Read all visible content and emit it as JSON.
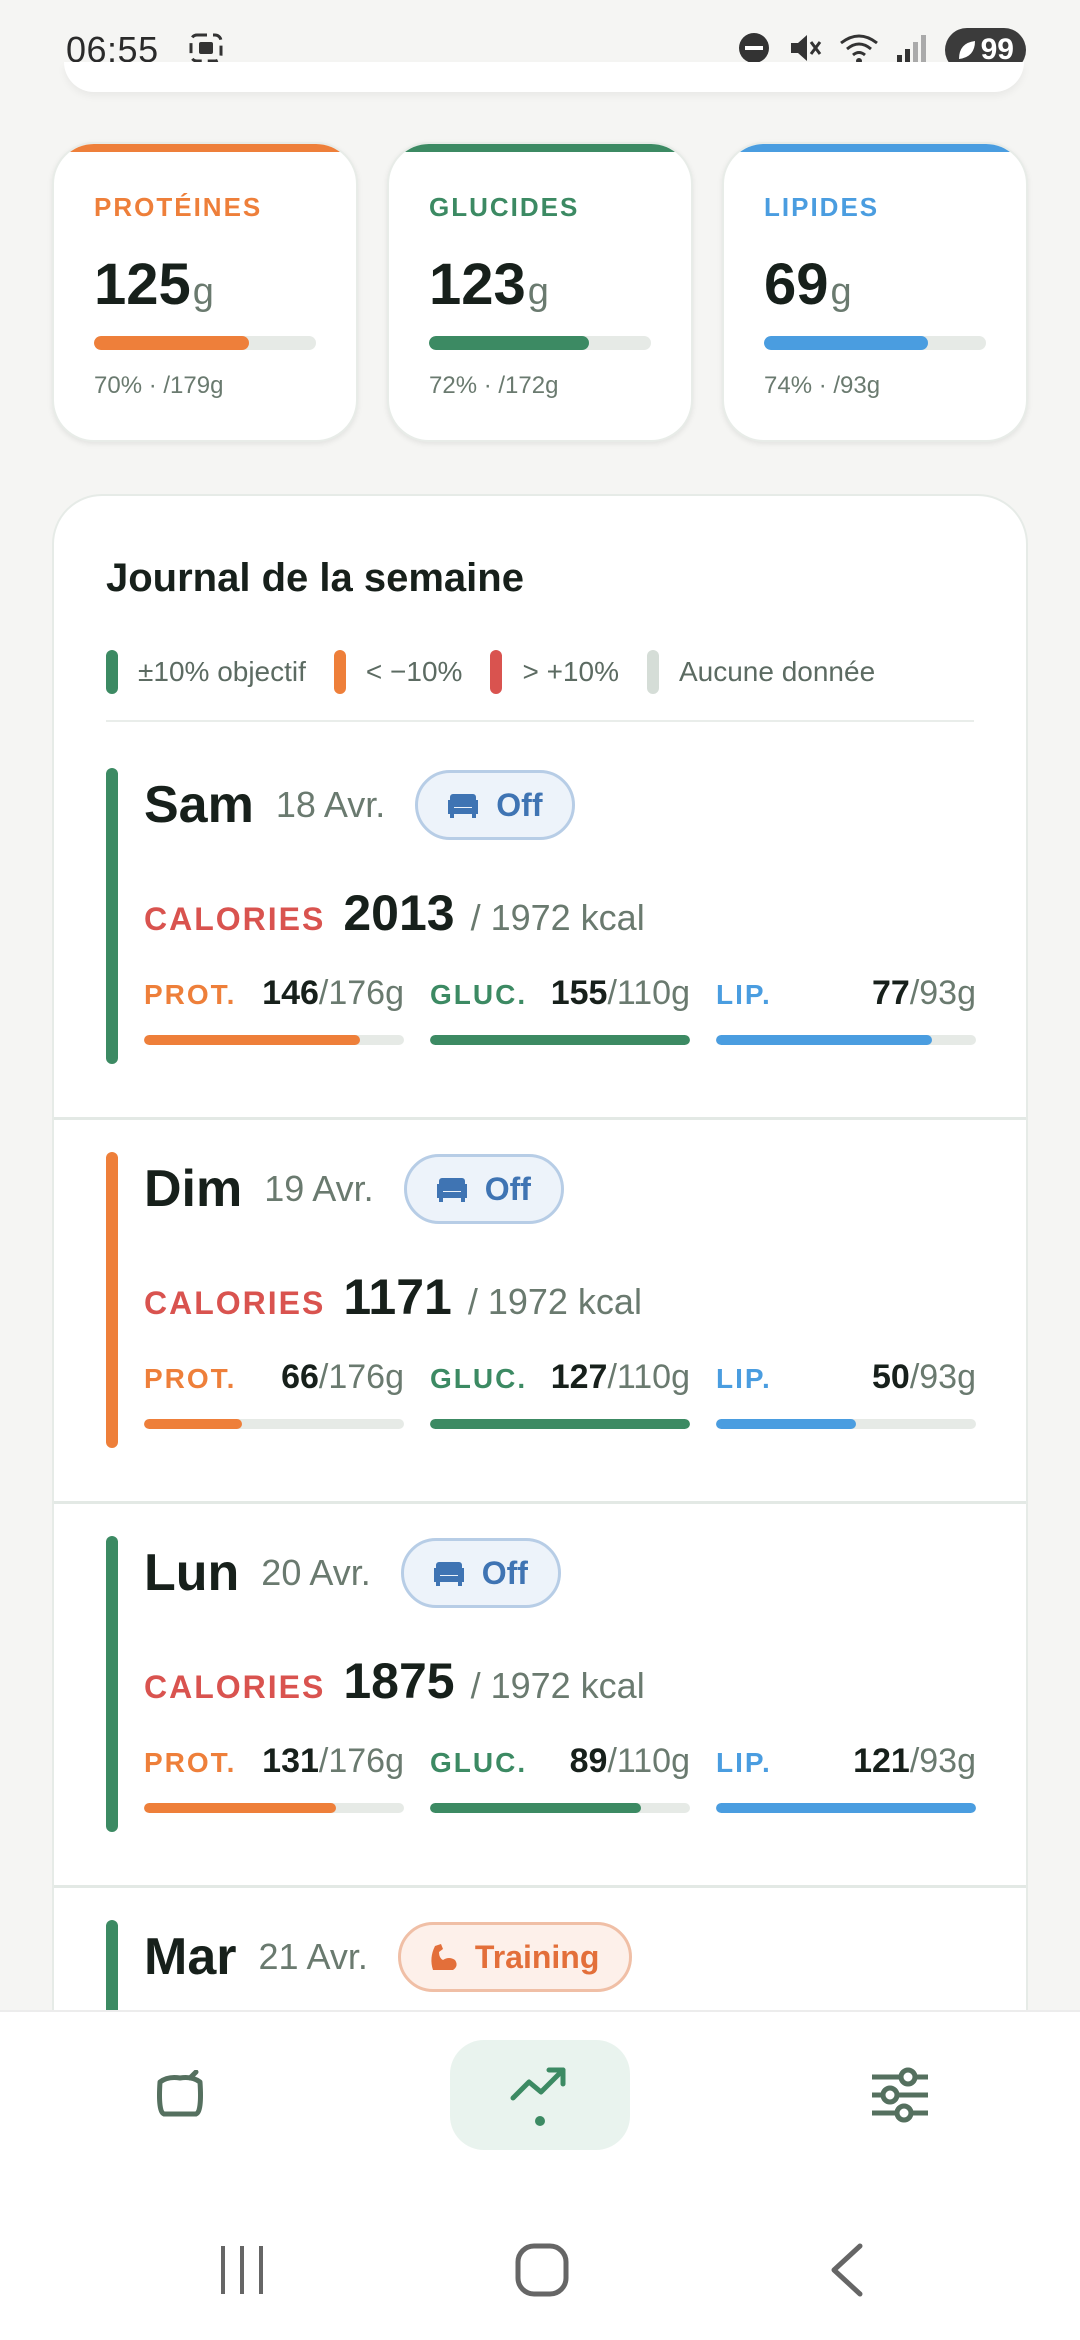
{
  "status_bar": {
    "time": "06:55",
    "battery": "99"
  },
  "colors": {
    "protein": "#ee7f3a",
    "carbs": "#3c8a63",
    "fat": "#4a9de0",
    "ok": "#3c8a63",
    "under": "#ee7f3a",
    "over": "#d9534f",
    "no_data": "#d5ddd7",
    "calories_label": "#d9534f"
  },
  "macros": [
    {
      "name": "PROTÉINES",
      "value": "125",
      "unit": "g",
      "progress": 0.7,
      "sub": "70% · /179g"
    },
    {
      "name": "GLUCIDES",
      "value": "123",
      "unit": "g",
      "progress": 0.72,
      "sub": "72% · /172g"
    },
    {
      "name": "LIPIDES",
      "value": "69",
      "unit": "g",
      "progress": 0.74,
      "sub": "74% · /93g"
    }
  ],
  "journal": {
    "title": "Journal de la semaine",
    "legend": [
      "±10% objectif",
      "< −10%",
      "> +10%",
      "Aucune donnée"
    ],
    "calories_label": "CALORIES",
    "prot_label": "PROT.",
    "gluc_label": "GLUC.",
    "lip_label": "LIP.",
    "days": [
      {
        "name": "Sam",
        "date": "18 Avr.",
        "badge": "Off",
        "badge_type": "off",
        "status": "ok",
        "calories": "2013",
        "calories_goal": "/ 1972 kcal",
        "prot": "146",
        "prot_goal": "/176g",
        "prot_progress": 0.83,
        "gluc": "155",
        "gluc_goal": "/110g",
        "gluc_progress": 1.0,
        "lip": "77",
        "lip_goal": "/93g",
        "lip_progress": 0.83
      },
      {
        "name": "Dim",
        "date": "19 Avr.",
        "badge": "Off",
        "badge_type": "off",
        "status": "under",
        "calories": "1171",
        "calories_goal": "/ 1972 kcal",
        "prot": "66",
        "prot_goal": "/176g",
        "prot_progress": 0.375,
        "gluc": "127",
        "gluc_goal": "/110g",
        "gluc_progress": 1.0,
        "lip": "50",
        "lip_goal": "/93g",
        "lip_progress": 0.54
      },
      {
        "name": "Lun",
        "date": "20 Avr.",
        "badge": "Off",
        "badge_type": "off",
        "status": "ok",
        "calories": "1875",
        "calories_goal": "/ 1972 kcal",
        "prot": "131",
        "prot_goal": "/176g",
        "prot_progress": 0.74,
        "gluc": "89",
        "gluc_goal": "/110g",
        "gluc_progress": 0.81,
        "lip": "121",
        "lip_goal": "/93g",
        "lip_progress": 1.0
      },
      {
        "name": "Mar",
        "date": "21 Avr.",
        "badge": "Training",
        "badge_type": "training",
        "status": "ok"
      }
    ]
  },
  "bottom_nav": [
    "food-icon",
    "trend-icon",
    "settings-sliders-icon"
  ],
  "system_nav": [
    "recents-icon",
    "home-icon",
    "back-icon"
  ]
}
